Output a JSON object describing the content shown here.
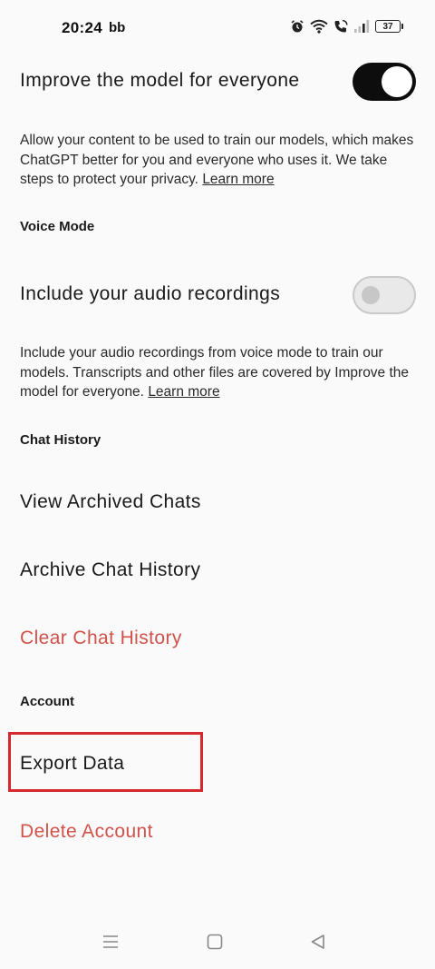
{
  "status_bar": {
    "time": "20:24",
    "app_indicator": "bb",
    "battery_level": "37",
    "icons": [
      "alarm-icon",
      "wifi-icon",
      "call-icon",
      "signal-icon",
      "battery-icon"
    ]
  },
  "improve_model": {
    "title": "Improve the model for everyone",
    "toggle_on": true,
    "description": "Allow your content to be used to train our models, which makes ChatGPT better for you and everyone who uses it. We take steps to protect your privacy.",
    "learn_more": "Learn more"
  },
  "voice_mode": {
    "header": "Voice Mode",
    "title": "Include your audio recordings",
    "toggle_on": false,
    "description": "Include your audio recordings from voice mode to train our models. Transcripts and other files are covered by Improve the model for everyone.",
    "learn_more": "Learn more"
  },
  "chat_history": {
    "header": "Chat History",
    "view_archived": "View Archived Chats",
    "archive_history": "Archive Chat History",
    "clear_history": "Clear Chat History"
  },
  "account": {
    "header": "Account",
    "export_data": "Export Data",
    "delete_account": "Delete Account"
  },
  "colors": {
    "danger": "#d0524a",
    "highlight": "#d42a2f",
    "toggle_on": "#0d0d0d"
  },
  "nav_bar": {
    "icons": [
      "menu-icon",
      "home-square-icon",
      "back-triangle-icon"
    ]
  }
}
